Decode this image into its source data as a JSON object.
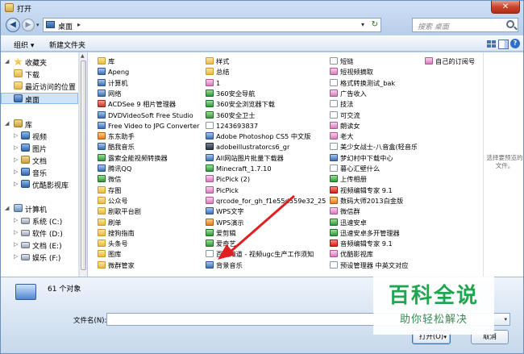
{
  "window": {
    "title": "打开",
    "close_label": "✕"
  },
  "nav": {
    "back_glyph": "◀",
    "forward_glyph": "▶",
    "address": "桌面",
    "address_sep": "▸",
    "search_placeholder": "搜索 桌面"
  },
  "toolbar": {
    "organize": "组织 ▾",
    "new_folder": "新建文件夹",
    "help": "?"
  },
  "sidebar": [
    {
      "label": "收藏夹",
      "icon": "star-icon"
    },
    {
      "label": "下载",
      "icon": "folder-icon"
    },
    {
      "label": "最近访问的位置",
      "icon": "folder-icon"
    },
    {
      "label": "桌面",
      "icon": "desktop-icon"
    },
    {
      "label": "库",
      "icon": "library-icon"
    },
    {
      "label": "视频",
      "icon": "video-icon"
    },
    {
      "label": "图片",
      "icon": "picture-icon"
    },
    {
      "label": "文档",
      "icon": "document-icon"
    },
    {
      "label": "音乐",
      "icon": "music-icon"
    },
    {
      "label": "优酷影视库",
      "icon": "video-icon"
    },
    {
      "label": "计算机",
      "icon": "computer-icon"
    },
    {
      "label": "系统 (C:)",
      "icon": "drive-icon"
    },
    {
      "label": "软件 (D:)",
      "icon": "drive-icon"
    },
    {
      "label": "文档 (E:)",
      "icon": "drive-icon"
    },
    {
      "label": "娱乐 (F:)",
      "icon": "drive-icon"
    }
  ],
  "files": {
    "col1": [
      "库",
      "Apeng",
      "计算机",
      "网络",
      "ACDSee 9 相片管理器",
      "DVDVideoSoft Free Studio",
      "Free Video to JPG Converter",
      "东东助手",
      "酷我音乐",
      "露索全能视频转换器",
      "腾讯QQ",
      "微信",
      "存图",
      "公众号",
      "剧歌平台剧",
      "刷单",
      "搜狗指南",
      "头条号",
      "图库",
      "微群管家"
    ],
    "col2": [
      "样式",
      "总结",
      "1",
      "360安全导航",
      "360安全浏览器下载",
      "360安全卫士",
      "1243693837",
      "Adobe Photoshop CS5 中文版",
      "adobeillustratorcs6_gr",
      "All网站图片批量下载器",
      "Minecraft_1.7.10",
      "PicPick (2)",
      "PicPick",
      "qrcode_for_gh_f1e55d559e32_258",
      "WPS文字",
      "WPS演示",
      "爱剪辑",
      "爱奇艺",
      "百度知道 - 视频ugc生产工作须知",
      "背景音乐"
    ],
    "col3": [
      "短链",
      "短视频摘取",
      "格式转换测试_bak",
      "广告收入",
      "技法",
      "可交流",
      "朗读女",
      "老大",
      "美少女战士-八音盒(轻音乐)",
      "梦幻村中下载中心",
      "暮心汇壁什么",
      "上传相册",
      "视频编辑专家 9.1",
      "数码大师2013白金版",
      "微信群",
      "迅速安卓",
      "迅速安卓多开管理器",
      "音频编辑专家 9.1",
      "优酷影视库",
      "预设管理器 中英文对应"
    ],
    "col4": [
      "自己的订阅号"
    ]
  },
  "preview": {
    "text": "选择要预览的文件。"
  },
  "status": {
    "count": "61 个对象"
  },
  "bottom": {
    "filename_label": "文件名(N):",
    "open_label": "打开(O)",
    "open_arrow": "▾",
    "cancel_label": "取消"
  },
  "watermark": {
    "big": "百科全说",
    "small": "助你轻松解决"
  },
  "colors": {
    "accent": "#1fa64f",
    "arrow": "#e02020",
    "selection": "#cde4fb"
  }
}
